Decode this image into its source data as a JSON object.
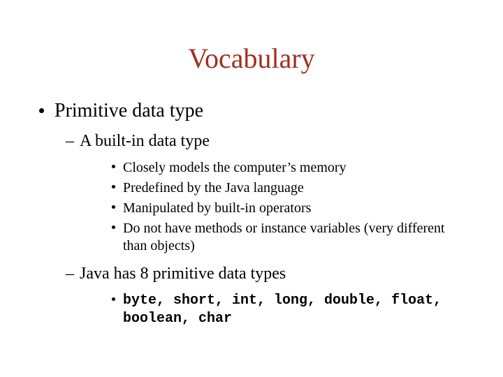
{
  "title": "Vocabulary",
  "l1": {
    "text": "Primitive data type"
  },
  "l2a": {
    "text": "A built-in data type"
  },
  "l3": {
    "a": "Closely models the computer’s memory",
    "b": "Predefined by the Java language",
    "c": "Manipulated by built-in operators",
    "d": "Do not have methods or instance variables (very different than objects)"
  },
  "l2b": {
    "text": "Java has 8 primitive data types"
  },
  "code": "byte, short, int, long, double, float, boolean, char"
}
